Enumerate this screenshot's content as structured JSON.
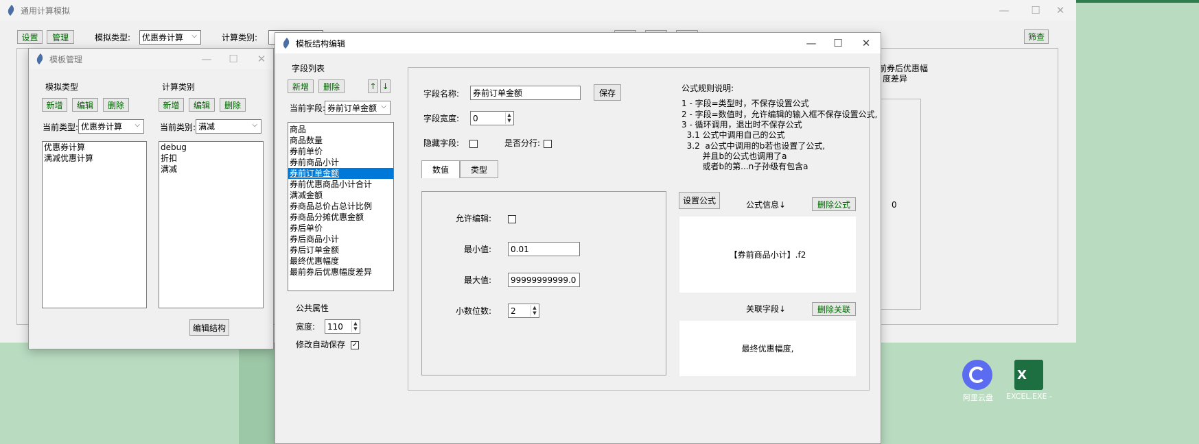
{
  "main_window": {
    "title": "通用计算模拟",
    "settings_btn": "设置",
    "manage_btn": "管理",
    "sim_type_label": "模拟类型:",
    "sim_type_value": "优惠券计算",
    "calc_type_label": "计算类别:",
    "filter_btn": "筛查",
    "bg_header_1": "前券后优惠幅",
    "bg_header_2": "度差异",
    "bg_value": "0"
  },
  "template_manager": {
    "title": "模板管理",
    "type_section": "模拟类型",
    "category_section": "计算类别",
    "add_btn": "新增",
    "edit_btn": "编辑",
    "delete_btn": "删除",
    "current_type_label": "当前类型:",
    "current_type_value": "优惠券计算",
    "current_category_label": "当前类别:",
    "current_category_value": "满减",
    "types": [
      "优惠券计算",
      "满减优惠计算"
    ],
    "categories": [
      "debug",
      "折扣",
      "满减"
    ],
    "edit_structure_btn": "编辑结构"
  },
  "structure_editor": {
    "title": "模板结构编辑",
    "field_list_label": "字段列表",
    "add_btn": "新增",
    "delete_btn": "删除",
    "up_arrow": "↑",
    "down_arrow": "↓",
    "current_field_label": "当前字段:",
    "current_field_value": "券前订单金额",
    "fields": [
      "商品",
      "商品数量",
      "券前单价",
      "券前商品小计",
      "券前订单金额",
      "券前优惠商品小计合计",
      "满减金额",
      "券商品总价占总计比例",
      "券商品分摊优惠金额",
      "券后单价",
      "券后商品小计",
      "券后订单金额",
      "最终优惠幅度",
      "最前券后优惠幅度差异"
    ],
    "selected_index": 4,
    "common_props_label": "公共属性",
    "width_label": "宽度:",
    "width_value": "110",
    "autosave_label": "修改自动保存",
    "autosave_checked": true,
    "field_name_label": "字段名称:",
    "field_name_value": "券前订单金额",
    "save_btn": "保存",
    "field_width_label": "字段宽度:",
    "field_width_value": "0",
    "hidden_label": "隐藏字段:",
    "newline_label": "是否分行:",
    "tab_numeric": "数值",
    "tab_type": "类型",
    "allow_edit_label": "允许编辑:",
    "min_label": "最小值:",
    "min_value": "0.01",
    "max_label": "最大值:",
    "max_value": "99999999999.0",
    "decimals_label": "小数位数:",
    "decimals_value": "2",
    "rules_title": "公式规则说明:",
    "rules": [
      "1 - 字段=类型时，不保存设置公式",
      "2 - 字段=数值时，允许编辑的输入框不保存设置公式,",
      "3 - 循环调用，退出时不保存公式",
      "  3.1 公式中调用自己的公式",
      "  3.2  a公式中调用的b若也设置了公式,",
      "        并且b的公式也调用了a",
      "        或者b的第...n子孙级有包含a"
    ],
    "set_formula_btn": "设置公式",
    "formula_info_label": "公式信息↓",
    "delete_formula_btn": "删除公式",
    "formula_text": "【券前商品小计】.f2",
    "related_label": "关联字段↓",
    "delete_related_btn": "删除关联",
    "related_text": "最终优惠幅度,"
  },
  "taskbar": {
    "icon1_label": "阿里云盘",
    "icon2_label": "EXCEL.EXE -"
  }
}
